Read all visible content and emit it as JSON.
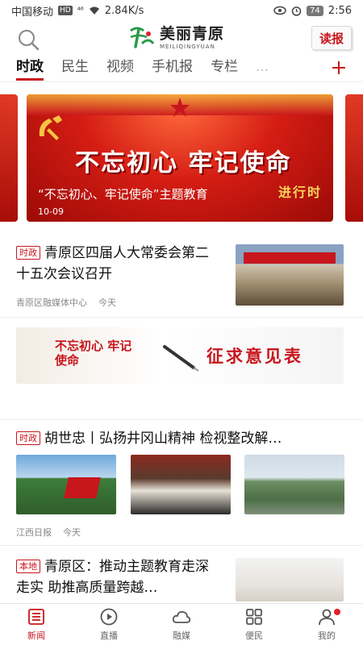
{
  "status_bar": {
    "carrier": "中国移动",
    "network_badge": "HD",
    "signal": "⁴⁶",
    "speed": "2.84K/s",
    "battery": "74",
    "time": "2:56"
  },
  "header": {
    "logo_cn": "美丽青原",
    "logo_en": "MEILIQINGYUAN",
    "read_paper_label": "读报"
  },
  "tabs": [
    {
      "label": "时政",
      "active": true
    },
    {
      "label": "民生"
    },
    {
      "label": "视频"
    },
    {
      "label": "手机报"
    },
    {
      "label": "专栏"
    },
    {
      "label": "..."
    }
  ],
  "banner": {
    "slogan": "不忘初心 牢记使命",
    "gold_text": "进行时",
    "caption": "“不忘初心、牢记使命”主题教育",
    "date": "10-09"
  },
  "news": [
    {
      "badge": "时政",
      "title": "青原区四届人大常委会第二十五次会议召开",
      "source": "青原区融媒体中心",
      "time": "今天"
    },
    {
      "ad_slogan": "不忘初心 牢记使命",
      "ad_text": "征求意见表"
    },
    {
      "badge": "时政",
      "title": "胡世忠丨弘扬井冈山精神 检视整改解…",
      "source": "江西日报",
      "time": "今天"
    },
    {
      "badge": "本地",
      "title": "青原区：推动主题教育走深走实 助推高质量跨越…"
    }
  ],
  "bottom_nav": [
    {
      "label": "新闻",
      "icon": "news-icon",
      "active": true
    },
    {
      "label": "直播",
      "icon": "play-icon"
    },
    {
      "label": "融媒",
      "icon": "cloud-icon"
    },
    {
      "label": "便民",
      "icon": "grid-icon"
    },
    {
      "label": "我的",
      "icon": "user-icon"
    }
  ],
  "colors": {
    "accent": "#c8161d"
  }
}
